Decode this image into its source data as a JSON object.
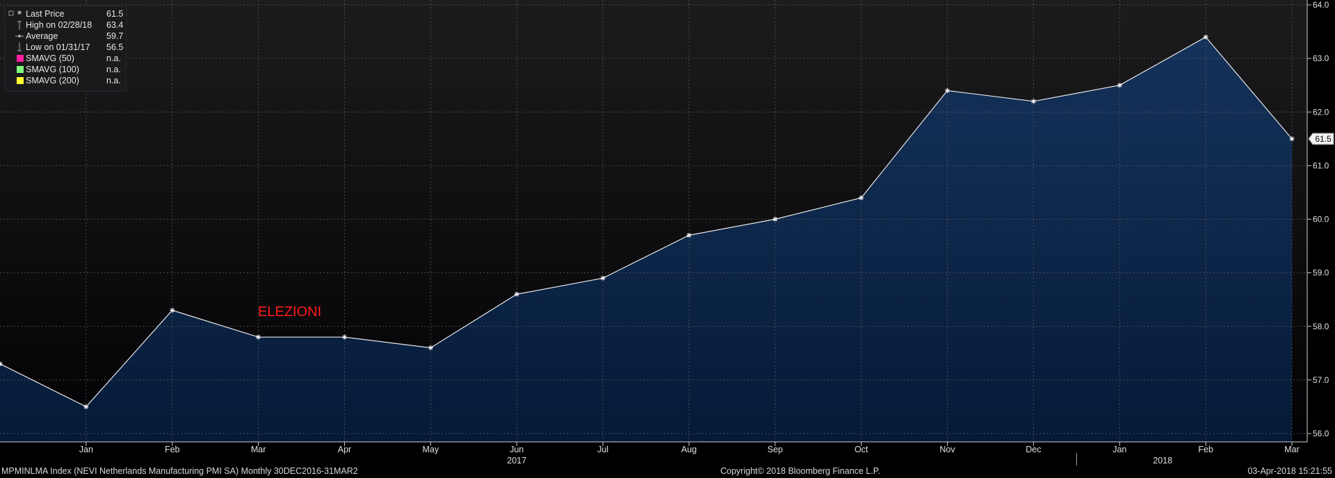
{
  "chart_data": {
    "type": "area",
    "annotation": "ELEZIONI",
    "x": [
      "Dec 2016",
      "Jan 2017",
      "Feb 2017",
      "Mar 2017",
      "Apr 2017",
      "May 2017",
      "Jun 2017",
      "Jul 2017",
      "Aug 2017",
      "Sep 2017",
      "Oct 2017",
      "Nov 2017",
      "Dec 2017",
      "Jan 2018",
      "Feb 2018",
      "Mar 2018"
    ],
    "x_tick_labels": [
      "Jan",
      "Feb",
      "Mar",
      "Apr",
      "May",
      "Jun",
      "Jul",
      "Aug",
      "Sep",
      "Oct",
      "Nov",
      "Dec",
      "Jan",
      "Feb",
      "Mar"
    ],
    "year_labels": [
      "2017",
      "2018"
    ],
    "series": [
      {
        "values": [
          57.3,
          56.5,
          58.3,
          57.8,
          57.8,
          57.6,
          58.6,
          58.9,
          59.7,
          60.0,
          60.4,
          62.4,
          62.2,
          62.5,
          63.4,
          61.5
        ]
      }
    ],
    "ylim": [
      55.9,
      64.1
    ],
    "y_ticks": [
      "56.0",
      "57.0",
      "58.0",
      "59.0",
      "60.0",
      "61.0",
      "62.0",
      "63.0",
      "64.0"
    ],
    "last_value_label": "61.5",
    "grid": true,
    "legend_position": "top-left",
    "colors": {
      "line": "#e8e8e8",
      "fill_top": "#15325a",
      "fill_bottom": "#051a38",
      "bg_top": "#1c1b1d",
      "bg_bottom": "#020205",
      "annotation": "#ff1a1a",
      "grid": "#5a5a5a"
    }
  },
  "legend": {
    "items": [
      {
        "label": "Last Price",
        "value": "61.5",
        "symbol": "asterisk"
      },
      {
        "label": "High on 02/28/18",
        "value": "63.4",
        "symbol": "high-marker"
      },
      {
        "label": "Average",
        "value": "59.7",
        "symbol": "average-marker"
      },
      {
        "label": "Low on 01/31/17",
        "value": "56.5",
        "symbol": "low-marker"
      },
      {
        "label": "SMAVG (50)",
        "value": "n.a.",
        "symbol": "swatch",
        "color": "#ff1fa0"
      },
      {
        "label": "SMAVG (100)",
        "value": "n.a.",
        "symbol": "swatch",
        "color": "#80ff80"
      },
      {
        "label": "SMAVG (200)",
        "value": "n.a.",
        "symbol": "swatch",
        "color": "#ffff33"
      }
    ]
  },
  "footer": {
    "left": "MPMINLMA Index (NEVI Netherlands Manufacturing PMI SA)  Monthly 30DEC2016-31MAR2",
    "center": "Copyright© 2018 Bloomberg Finance L.P.",
    "right": "03-Apr-2018 15:21:55"
  }
}
